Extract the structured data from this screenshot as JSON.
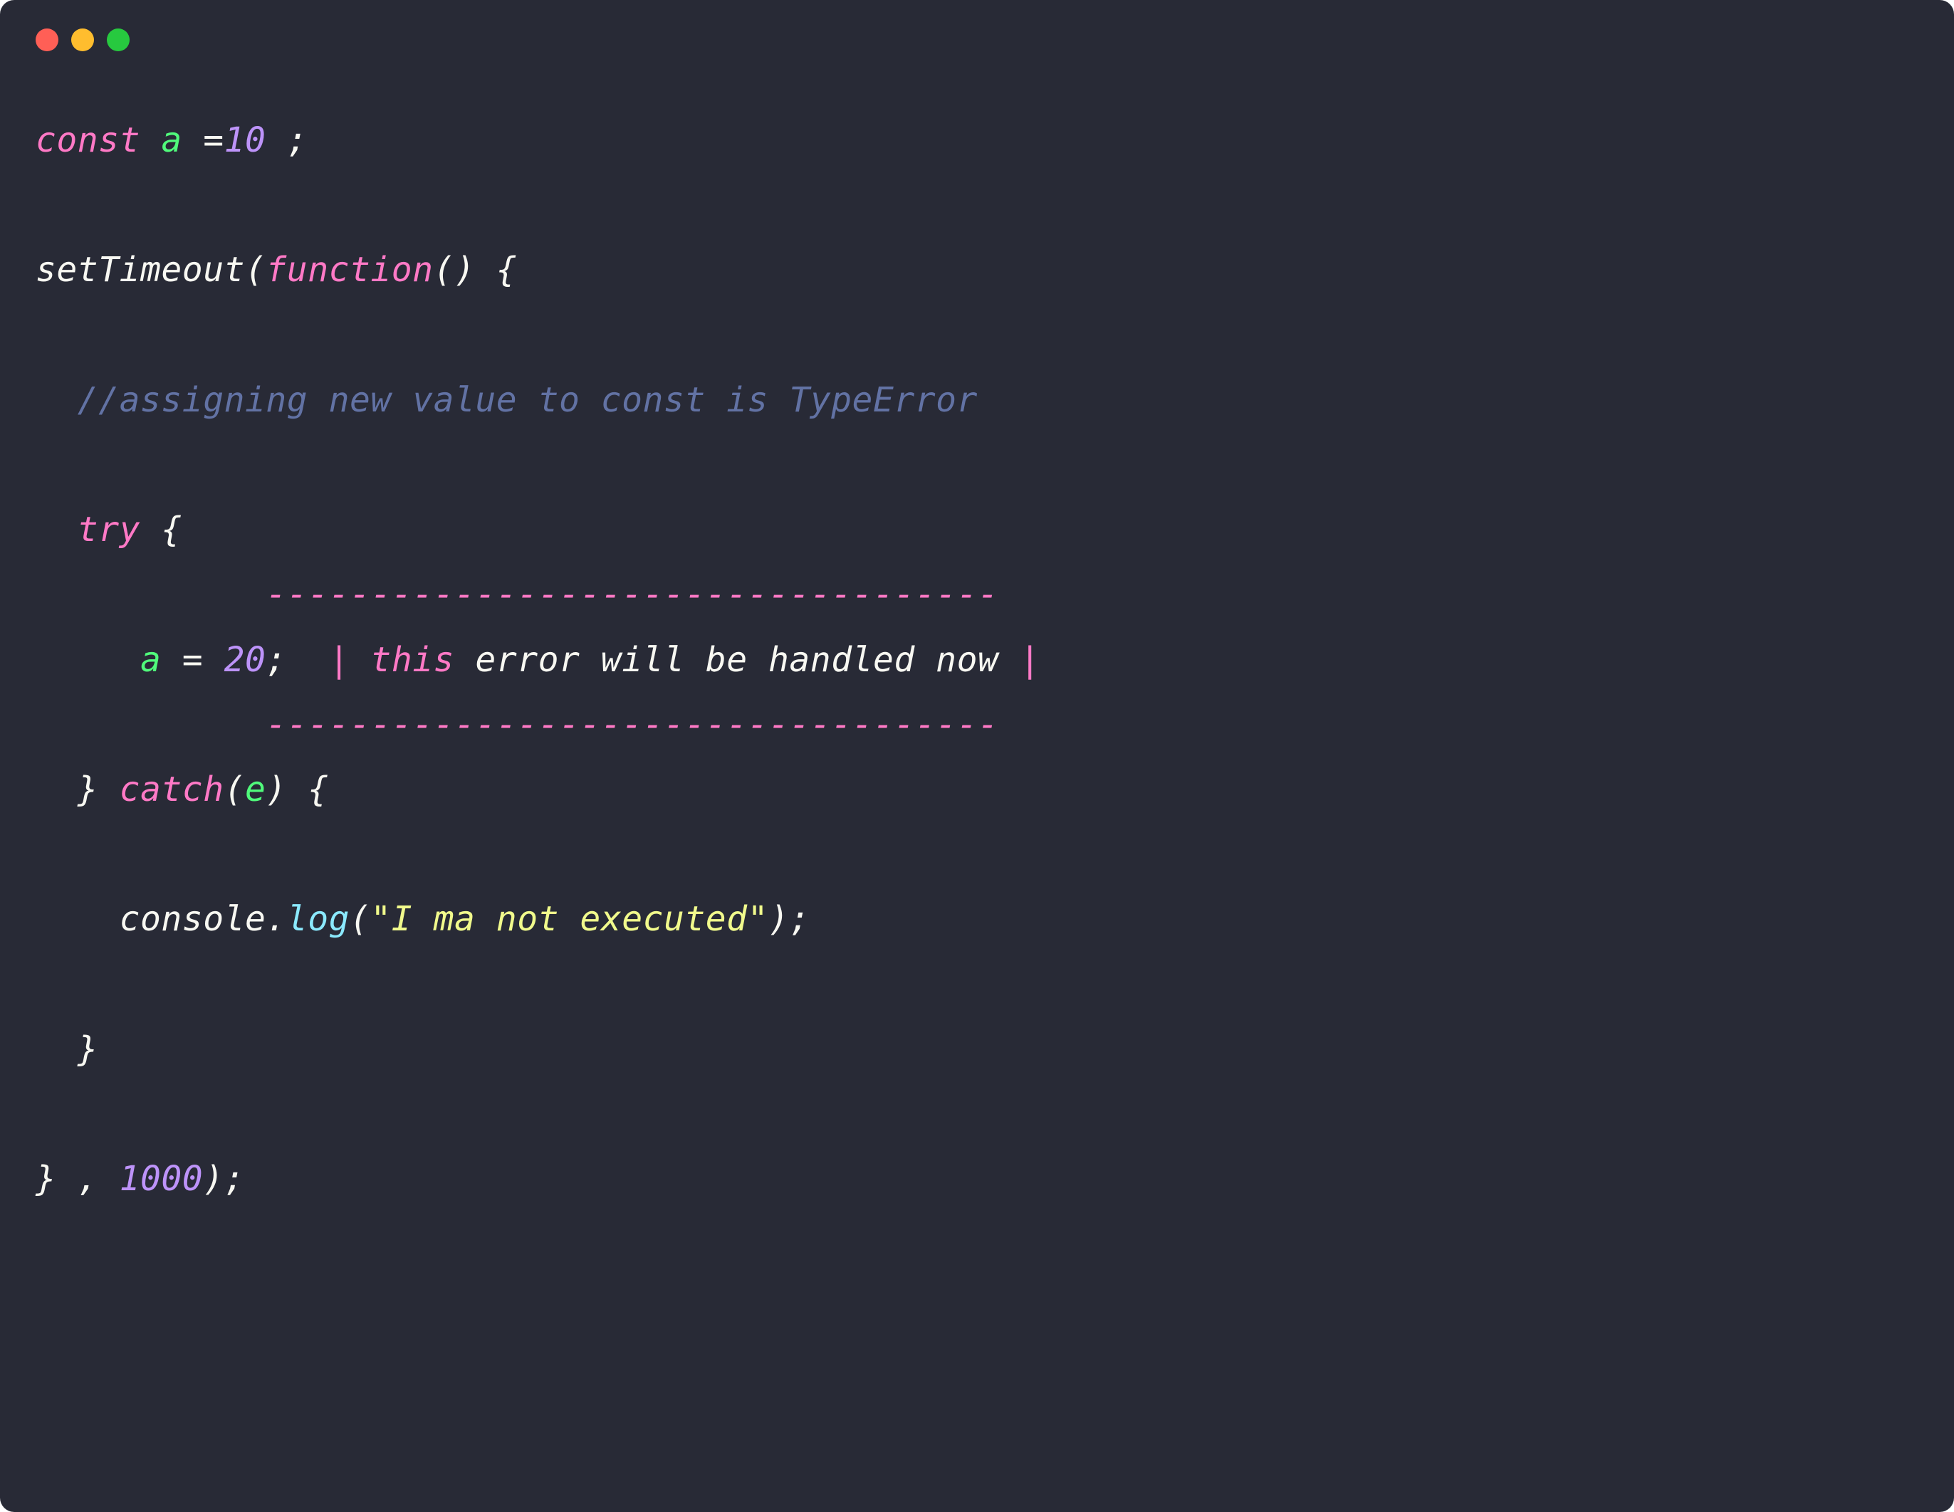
{
  "titlebar": {
    "redLabel": "close",
    "yellowLabel": "minimize",
    "greenLabel": "zoom"
  },
  "code": {
    "line1": {
      "const": "const",
      "a": "a",
      "eq": "=",
      "ten": "10",
      "semi": " ;"
    },
    "line2": {
      "setTimeout": "setTimeout",
      "lparen": "(",
      "function": "function",
      "parens": "()",
      "brace": " {"
    },
    "line3": {
      "comment": "//assigning new value to const is TypeError"
    },
    "line4": {
      "try": "try",
      "brace": " {"
    },
    "line5": {
      "dashes": "-----------------------------------"
    },
    "line6": {
      "a": "a",
      "eq": " = ",
      "twenty": "20",
      "semi": ";",
      "pipe1": "|",
      "thisk": "this",
      "annot": " error will be handled now ",
      "pipe2": "|"
    },
    "line7": {
      "dashes": "-----------------------------------"
    },
    "line8": {
      "rbrace": "}",
      "catch": " catch",
      "lparen": "(",
      "e": "e",
      "rparen": ")",
      "brace": " {"
    },
    "line9": {
      "console": "console",
      "dot": ".",
      "log": "log",
      "lparen": "(",
      "str": "\"I ma not executed\"",
      "rparen": ");"
    },
    "line10": {
      "rbrace": "}"
    },
    "line11": {
      "rbrace": "}",
      "comma": " , ",
      "thousand": "1000",
      "rparen": ");"
    }
  }
}
